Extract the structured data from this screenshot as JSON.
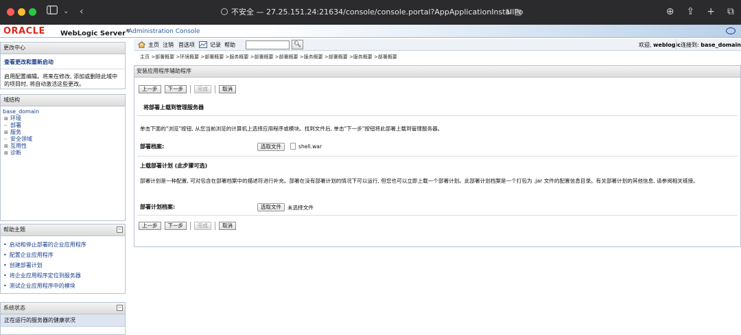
{
  "browser": {
    "address_prefix": "不安全 — ",
    "url": "27.25.151.24:21634/console/console.portal?AppApplicationInstallPortlet_",
    "insecure_label": "不安全"
  },
  "header": {
    "logo": "ORACLE",
    "product": "WebLogic Server",
    "registered": "®",
    "subtitle": "Administration Console"
  },
  "change_center": {
    "title": "更改中心",
    "link": "查看更改和重新启动",
    "text": "启用配置编辑。将来在修改, 添加或删除此域中的项目时, 将自动激活这些更改。"
  },
  "domain_structure": {
    "title": "域结构",
    "root": "base_domain",
    "items": [
      {
        "sign": "⊞",
        "label": "环境"
      },
      {
        "sign": "",
        "label": "部署"
      },
      {
        "sign": "⊞",
        "label": "服务"
      },
      {
        "sign": "",
        "label": "安全领域"
      },
      {
        "sign": "⊞",
        "label": "互用性"
      },
      {
        "sign": "⊞",
        "label": "诊断"
      }
    ]
  },
  "help_topics": {
    "title": "帮助主题",
    "items": [
      "启动和停止部署的企业应用程序",
      "配置企业应用程序",
      "创建部署计划",
      "将企业应用程序定位到服务器",
      "测试企业应用程序中的模块"
    ]
  },
  "system_status": {
    "title": "系统状态",
    "subtitle": "正在运行的服务器的健康状况"
  },
  "toolbar": {
    "home": "主页",
    "logout": "注销",
    "preferences": "首选项",
    "record": "记录",
    "help": "帮助",
    "search_placeholder": "",
    "welcome_prefix": "欢迎, ",
    "user": "weblogic",
    "connected_prefix": "连接到: ",
    "domain": "base_domain"
  },
  "breadcrumb": "主页 >部署概要 >环境概要 >部署概要 >服务概要 >部署概要 >部署概要 >服务概要 >部署概要 >服务概要 >部署概要",
  "main": {
    "title": "安装应用程序辅助程序",
    "buttons": {
      "back": "上一步",
      "next": "下一步",
      "finish": "完成",
      "cancel": "取消"
    },
    "upload_heading": "将部署上载到管理服务器",
    "upload_desc": "单击下面的\"浏览\"按钮, 从您当前浏览的计算机上选择应用程序或模块。找到文件后, 单击\"下一步\"按钮将此部署上载到管理服务器。",
    "archive_label": "部署档案:",
    "choose_file": "选取文件",
    "archive_file": "shell.war",
    "plan_heading": "上载部署计划 (此步骤可选)",
    "plan_desc": "部署计划是一种配置, 可对包含在部署档案中的描述符进行补充。部署在没有部署计划的情况下可以运行, 但您也可以立即上载一个部署计划。此部署计划档案是一个打包为 .jar 文件的配置信息目录。有关部署计划的其他信息, 请参阅相关链接。",
    "plan_label": "部署计划档案:",
    "plan_file": "未选择文件"
  },
  "colors": {
    "oracle_red": "#e0261b",
    "link_blue": "#1a3e8c",
    "chrome_bg": "#2b2b2d"
  }
}
